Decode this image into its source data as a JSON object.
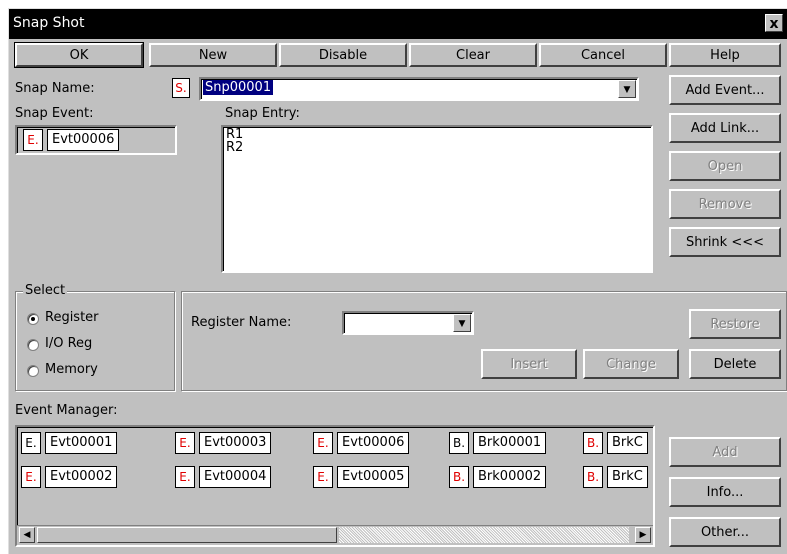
{
  "window": {
    "title": "Snap Shot",
    "close_glyph": "x"
  },
  "top_buttons": {
    "ok": "OK",
    "new": "New",
    "disable": "Disable",
    "clear": "Clear",
    "cancel": "Cancel",
    "help": "Help"
  },
  "snap": {
    "name_label": "Snap Name:",
    "name_badge": "S.",
    "name_value": "Snp00001",
    "event_label": "Snap Event:",
    "event_badge": "E.",
    "event_value": "Evt00006",
    "entry_label": "Snap Entry:",
    "entries": [
      "R1",
      "R2"
    ]
  },
  "side_buttons": {
    "add_event": "Add Event...",
    "add_link": "Add Link...",
    "open": "Open",
    "remove": "Remove",
    "shrink": "Shrink <<<"
  },
  "select": {
    "legend": "Select",
    "options": [
      "Register",
      "I/O Reg",
      "Memory"
    ],
    "selected": "Register"
  },
  "register": {
    "name_label": "Register Name:",
    "name_value": ""
  },
  "mid_buttons": {
    "insert": "Insert",
    "change": "Change",
    "restore": "Restore",
    "delete": "Delete"
  },
  "event_manager": {
    "label": "Event Manager:",
    "row1": [
      {
        "badge": "E.",
        "name": "Evt00001",
        "red": false
      },
      {
        "badge": "E.",
        "name": "Evt00003",
        "red": true
      },
      {
        "badge": "E.",
        "name": "Evt00006",
        "red": true
      },
      {
        "badge": "B.",
        "name": "Brk00001",
        "red": false
      },
      {
        "badge": "B.",
        "name": "BrkC",
        "red": true
      }
    ],
    "row2": [
      {
        "badge": "E.",
        "name": "Evt00002",
        "red": true
      },
      {
        "badge": "E.",
        "name": "Evt00004",
        "red": true
      },
      {
        "badge": "E.",
        "name": "Evt00005",
        "red": true
      },
      {
        "badge": "B.",
        "name": "Brk00002",
        "red": true
      },
      {
        "badge": "B.",
        "name": "BrkC",
        "red": true
      }
    ]
  },
  "em_buttons": {
    "add": "Add",
    "info": "Info...",
    "other": "Other..."
  },
  "colors": {
    "badge_red": "#e00000",
    "face": "#c0c0c0",
    "title_bg": "#000000"
  }
}
